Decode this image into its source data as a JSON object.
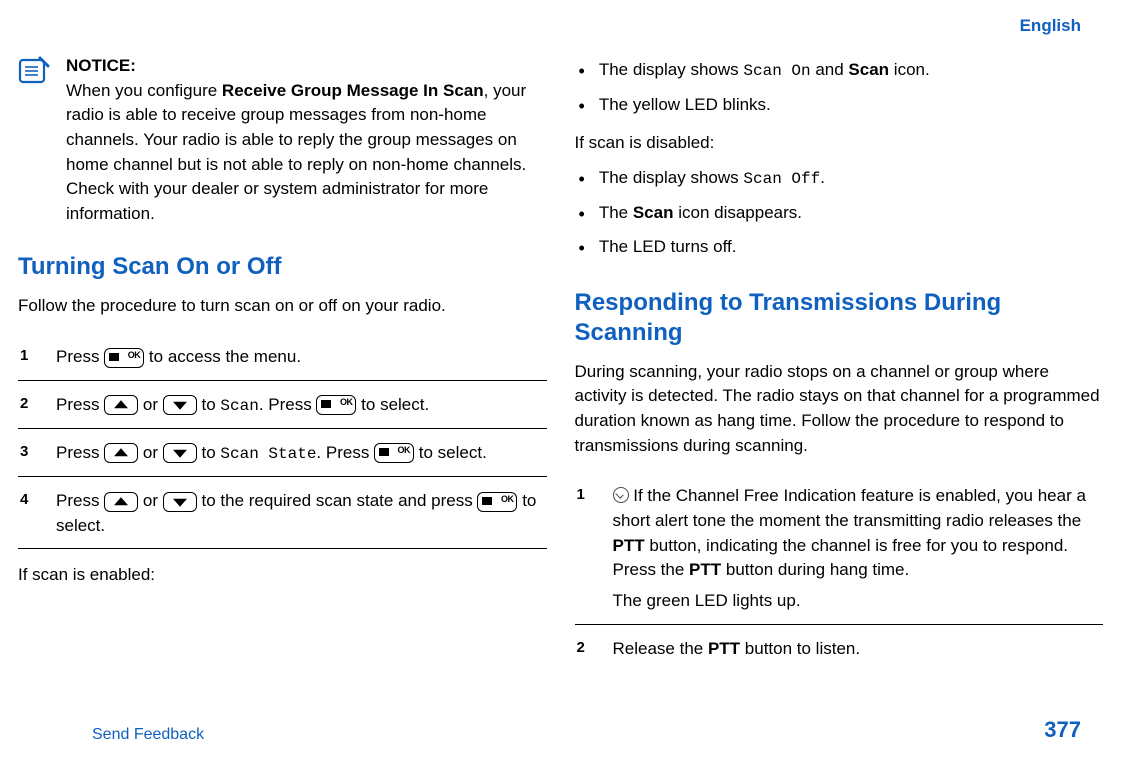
{
  "language": "English",
  "notice": {
    "label": "NOTICE:",
    "text_before": "When you configure ",
    "bold": "Receive Group Message In Scan",
    "text_after": ", your radio is able to receive group messages from non-home channels. Your radio is able to reply the group messages on home channel but is not able to reply on non-home channels. Check with your dealer or system administrator for more information."
  },
  "section1": {
    "title": "Turning Scan On or Off",
    "intro": "Follow the procedure to turn scan on or off on your radio.",
    "steps": [
      {
        "pre": "Press ",
        "seg1": " to access the menu."
      },
      {
        "pre": "Press ",
        "mid": " or ",
        "to": " to ",
        "mono": "Scan",
        "press": ". Press ",
        "tail": " to select."
      },
      {
        "pre": "Press ",
        "mid": " or ",
        "to": " to ",
        "mono": "Scan State",
        "press": ". Press ",
        "tail": " to select."
      },
      {
        "pre": "Press ",
        "mid": " or ",
        "seg": " to the required scan state and press ",
        "tail": " to select."
      }
    ],
    "enabled_label": "If scan is enabled:"
  },
  "enabled_list": [
    {
      "pre": "The display shows ",
      "mono": "Scan On",
      "mid": " and ",
      "bold": "Scan",
      "post": " icon."
    },
    {
      "text": "The yellow LED blinks."
    }
  ],
  "disabled_label": "If scan is disabled:",
  "disabled_list": [
    {
      "pre": "The display shows ",
      "mono": "Scan Off",
      "post": "."
    },
    {
      "pre": "The ",
      "bold": "Scan",
      "post": " icon disappears."
    },
    {
      "text": "The LED turns off."
    }
  ],
  "section2": {
    "title": "Responding to Transmissions During Scanning",
    "intro": "During scanning, your radio stops on a channel or group where activity is detected. The radio stays on that channel for a programmed duration known as hang time. Follow the procedure to respond to transmissions during scanning.",
    "steps": [
      {
        "p1_pre": " If the Channel Free Indication feature is enabled, you hear a short alert tone the moment the transmitting radio releases the ",
        "b1": "PTT",
        "p1_mid": " button, indicating the channel is free for you to respond. Press the ",
        "b2": "PTT",
        "p1_post": " button during hang time.",
        "p2": "The green LED lights up."
      },
      {
        "p1_pre": "Release the ",
        "b1": "PTT",
        "p1_post": " button to listen."
      }
    ]
  },
  "footer": {
    "feedback": "Send Feedback",
    "page": "377"
  }
}
